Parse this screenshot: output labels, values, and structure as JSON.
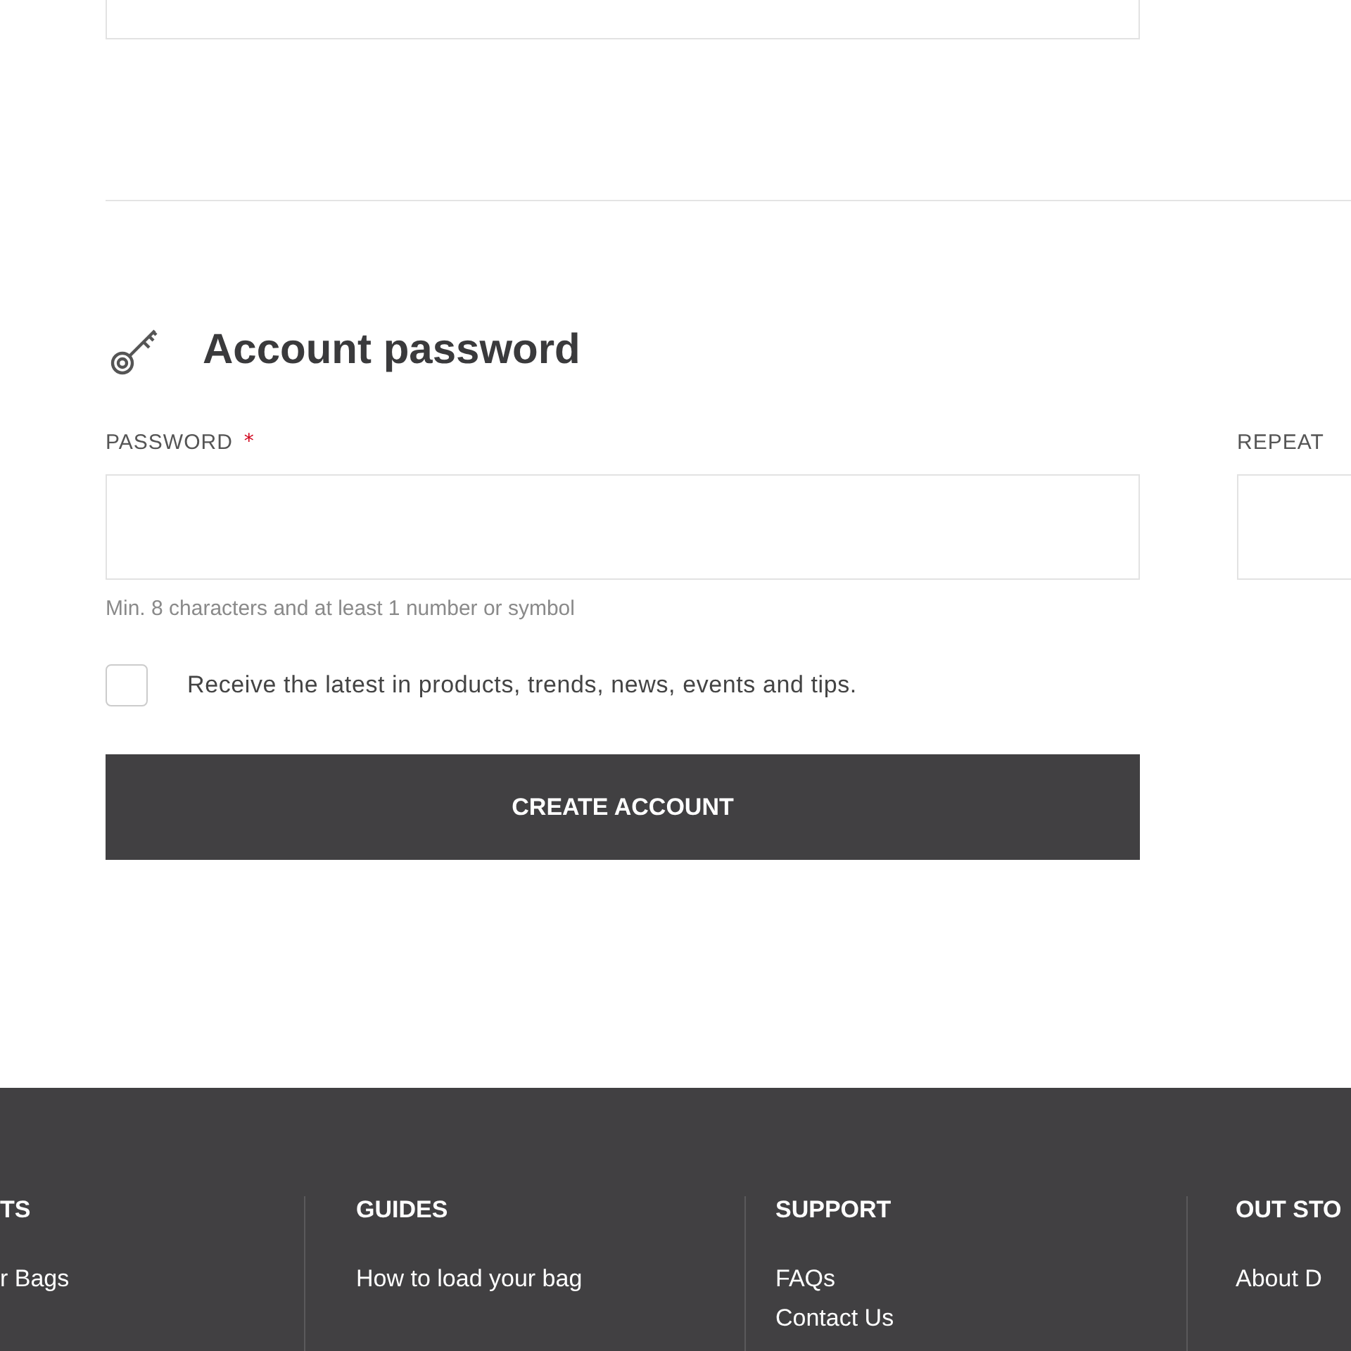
{
  "password_section": {
    "title": "Account password",
    "password": {
      "label": "PASSWORD",
      "required_mark": "*",
      "hint": "Min. 8 characters and at least 1 number or symbol"
    },
    "repeat": {
      "label": "REPEAT"
    },
    "newsletter": {
      "label": "Receive the latest in products, trends, news, events and tips.",
      "checked": false
    },
    "submit": "CREATE ACCOUNT"
  },
  "footer": {
    "columns": [
      {
        "heading": "TS",
        "links": [
          "r Bags"
        ]
      },
      {
        "heading": "GUIDES",
        "links": [
          "How to load your bag"
        ]
      },
      {
        "heading": "SUPPORT",
        "links": [
          "FAQs",
          "Contact Us"
        ]
      },
      {
        "heading": "OUT STO",
        "links": [
          "About D"
        ]
      }
    ]
  }
}
